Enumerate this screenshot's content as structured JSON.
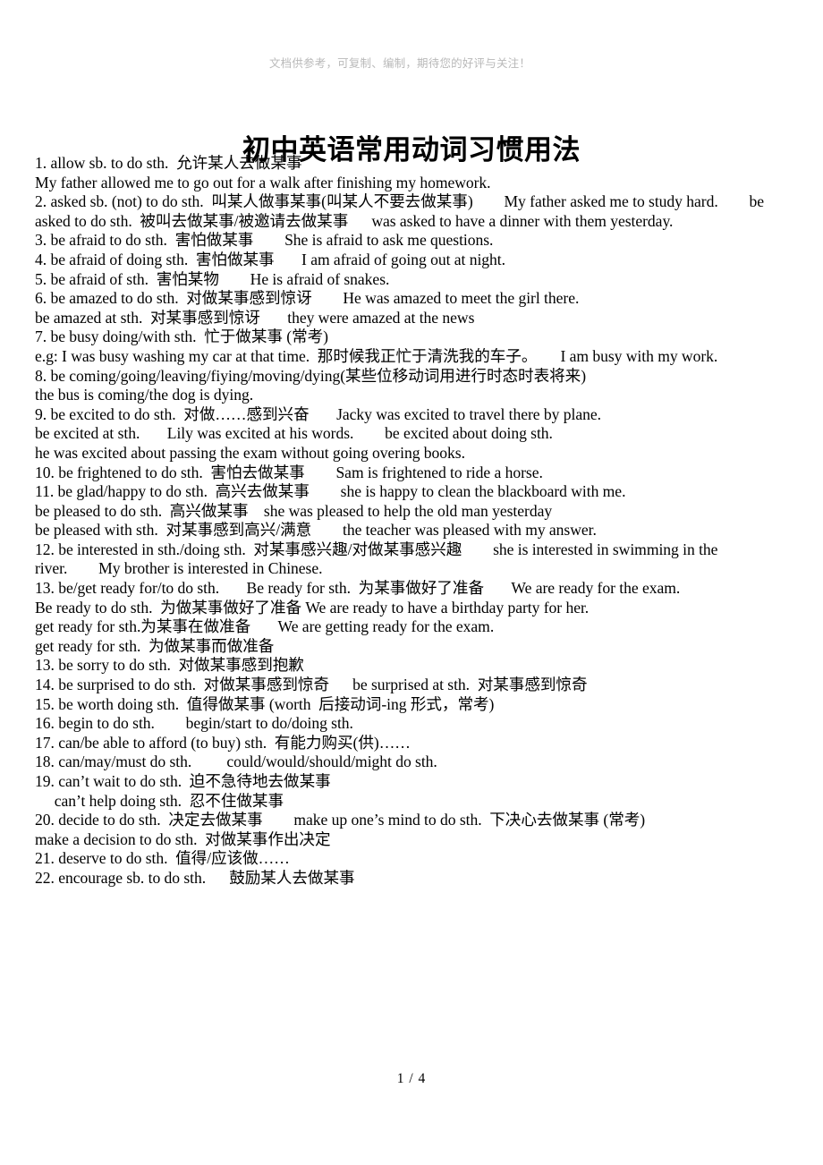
{
  "header": {
    "watermark": "文档供参考，可复制、编制，期待您的好评与关注！",
    "watermark_color": "#b9b9b9"
  },
  "document": {
    "title": "初中英语常用动词习惯用法",
    "page_label": "1 / 4",
    "text_color": "#000000",
    "background_color": "#ffffff"
  },
  "content": {
    "lines": [
      "1. allow sb. to do sth.  允许某人去做某事",
      "My father allowed me to go out for a walk after finishing my homework.",
      "2. asked sb. (not) to do sth.  叫某人做事某事(叫某人不要去做某事)        My father asked me to study hard.        be",
      "asked to do sth.  被叫去做某事/被邀请去做某事      was asked to have a dinner with them yesterday.",
      "3. be afraid to do sth.  害怕做某事        She is afraid to ask me questions.",
      "4. be afraid of doing sth.  害怕做某事       I am afraid of going out at night.",
      "5. be afraid of sth.  害怕某物        He is afraid of snakes.",
      "6. be amazed to do sth.  对做某事感到惊讶        He was amazed to meet the girl there.",
      "be amazed at sth.  对某事感到惊讶       they were amazed at the news",
      "7. be busy doing/with sth.  忙于做某事 (常考)",
      "e.g: I was busy washing my car at that time.  那时候我正忙于清洗我的车子。      I am busy with my work.",
      "8. be coming/going/leaving/fiying/moving/dying(某些位移动词用进行时态时表将来)",
      "the bus is coming/the dog is dying.",
      "9. be excited to do sth.  对做……感到兴奋       Jacky was excited to travel there by plane.",
      "be excited at sth.       Lily was excited at his words.        be excited about doing sth.",
      "he was excited about passing the exam without going overing books.",
      "10. be frightened to do sth.  害怕去做某事        Sam is frightened to ride a horse.",
      "11. be glad/happy to do sth.  高兴去做某事        she is happy to clean the blackboard with me.",
      "be pleased to do sth.  高兴做某事    she was pleased to help the old man yesterday",
      "be pleased with sth.  对某事感到高兴/满意        the teacher was pleased with my answer.",
      "12. be interested in sth./doing sth.  对某事感兴趣/对做某事感兴趣        she is interested in swimming in the",
      "river.        My brother is interested in Chinese.",
      "13. be/get ready for/to do sth.       Be ready for sth.  为某事做好了准备       We are ready for the exam.",
      "Be ready to do sth.  为做某事做好了准备 We are ready to have a birthday party for her.",
      "get ready for sth.为某事在做准备       We are getting ready for the exam.",
      "get ready for sth.  为做某事而做准备",
      "13. be sorry to do sth.  对做某事感到抱歉",
      "14. be surprised to do sth.  对做某事感到惊奇      be surprised at sth.  对某事感到惊奇",
      "15. be worth doing sth.  值得做某事 (worth  后接动词-ing 形式，常考)",
      "16. begin to do sth.        begin/start to do/doing sth.",
      "17. can/be able to afford (to buy) sth.  有能力购买(供)……",
      "18. can/may/must do sth.         could/would/should/might do sth.",
      "19. can’t wait to do sth.  迫不急待地去做某事",
      "     can’t help doing sth.  忍不住做某事",
      "20. decide to do sth.  决定去做某事        make up one’s mind to do sth.  下决心去做某事 (常考)",
      "make a decision to do sth.  对做某事作出决定",
      "21. deserve to do sth.  值得/应该做……",
      "22. encourage sb. to do sth.      鼓励某人去做某事"
    ]
  }
}
